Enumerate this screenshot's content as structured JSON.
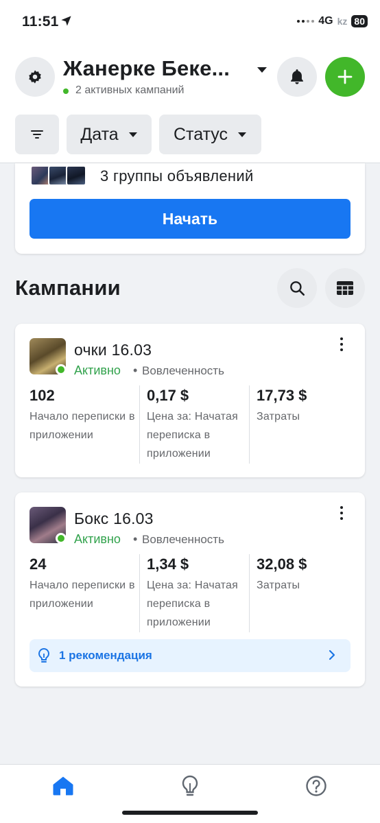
{
  "status_bar": {
    "time": "11:51",
    "network": "4G",
    "battery": "80",
    "watermark": "kz"
  },
  "header": {
    "account_name": "Жанерке Беке...",
    "account_subtitle": "2 активных кампаний",
    "filters": {
      "date_label": "Дата",
      "status_label": "Статус"
    }
  },
  "promo": {
    "text": "3 группы объявлений",
    "button_label": "Начать"
  },
  "section": {
    "title": "Кампании"
  },
  "campaigns": [
    {
      "name": "очки 16.03",
      "status": "Активно",
      "separator": "•",
      "objective": "Вовлеченность",
      "metrics": [
        {
          "value": "102",
          "label": "Начало переписки в приложении"
        },
        {
          "value": "0,17 $",
          "label": "Цена за: Начатая переписка в приложении"
        },
        {
          "value": "17,73 $",
          "label": "Затраты"
        }
      ]
    },
    {
      "name": "Бокс 16.03",
      "status": "Активно",
      "separator": "•",
      "objective": "Вовлеченность",
      "metrics": [
        {
          "value": "24",
          "label": "Начало переписки в приложении"
        },
        {
          "value": "1,34 $",
          "label": "Цена за: Начатая переписка в приложении"
        },
        {
          "value": "32,08 $",
          "label": "Затраты"
        }
      ],
      "recommendation": "1 рекомендация"
    }
  ],
  "colors": {
    "accent_blue": "#1877f2",
    "active_green": "#42b72a",
    "status_green_text": "#31a24c",
    "recommend_bg": "#e7f3ff"
  },
  "icons": [
    "settings-icon",
    "chevron-down-icon",
    "bell-icon",
    "plus-icon",
    "filter-icon",
    "search-icon",
    "table-grid-icon",
    "more-vertical-icon",
    "lightbulb-icon",
    "chevron-right-icon",
    "home-icon",
    "help-icon"
  ]
}
